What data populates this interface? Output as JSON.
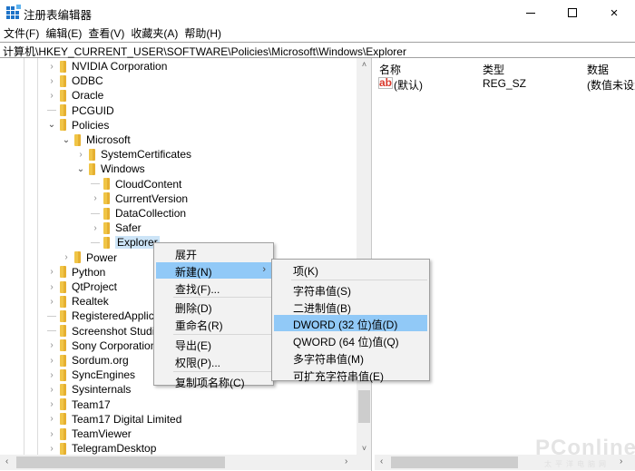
{
  "window": {
    "title": "注册表编辑器",
    "icon": "regedit-icon",
    "controls": {
      "minimize": "minimize-icon",
      "maximize": "maximize-icon",
      "close": "×"
    }
  },
  "menubar": [
    "文件(F)",
    "编辑(E)",
    "查看(V)",
    "收藏夹(A)",
    "帮助(H)"
  ],
  "address": "计算机\\HKEY_CURRENT_USER\\SOFTWARE\\Policies\\Microsoft\\Windows\\Explorer",
  "tree": [
    {
      "label": "NVIDIA Corporation",
      "level": 0,
      "state": "collapsed"
    },
    {
      "label": "ODBC",
      "level": 0,
      "state": "collapsed"
    },
    {
      "label": "Oracle",
      "level": 0,
      "state": "collapsed"
    },
    {
      "label": "PCGUID",
      "level": 0,
      "state": "leaf"
    },
    {
      "label": "Policies",
      "level": 0,
      "state": "expanded"
    },
    {
      "label": "Microsoft",
      "level": 1,
      "state": "expanded"
    },
    {
      "label": "SystemCertificates",
      "level": 2,
      "state": "collapsed"
    },
    {
      "label": "Windows",
      "level": 2,
      "state": "expanded"
    },
    {
      "label": "CloudContent",
      "level": 3,
      "state": "leaf"
    },
    {
      "label": "CurrentVersion",
      "level": 3,
      "state": "collapsed"
    },
    {
      "label": "DataCollection",
      "level": 3,
      "state": "leaf"
    },
    {
      "label": "Safer",
      "level": 3,
      "state": "collapsed"
    },
    {
      "label": "Explorer",
      "level": 3,
      "state": "leaf",
      "selected": true
    },
    {
      "label": "Power",
      "level": 1,
      "state": "collapsed"
    },
    {
      "label": "Python",
      "level": 0,
      "state": "collapsed"
    },
    {
      "label": "QtProject",
      "level": 0,
      "state": "collapsed"
    },
    {
      "label": "Realtek",
      "level": 0,
      "state": "collapsed"
    },
    {
      "label": "RegisteredApplications",
      "level": 0,
      "state": "leaf"
    },
    {
      "label": "Screenshot Studio",
      "level": 0,
      "state": "leaf"
    },
    {
      "label": "Sony Corporation",
      "level": 0,
      "state": "collapsed"
    },
    {
      "label": "Sordum.org",
      "level": 0,
      "state": "collapsed"
    },
    {
      "label": "SyncEngines",
      "level": 0,
      "state": "collapsed"
    },
    {
      "label": "Sysinternals",
      "level": 0,
      "state": "collapsed"
    },
    {
      "label": "Team17",
      "level": 0,
      "state": "collapsed"
    },
    {
      "label": "Team17 Digital Limited",
      "level": 0,
      "state": "collapsed"
    },
    {
      "label": "TeamViewer",
      "level": 0,
      "state": "collapsed"
    },
    {
      "label": "TelegramDesktop",
      "level": 0,
      "state": "collapsed"
    }
  ],
  "list": {
    "columns": [
      "名称",
      "类型",
      "数据"
    ],
    "rows": [
      {
        "icon": "ab",
        "name": "(默认)",
        "type": "REG_SZ",
        "data": "(数值未设置)"
      }
    ]
  },
  "context_menu": {
    "items": [
      {
        "label": "展开"
      },
      {
        "label": "新建(N)",
        "submenu": true,
        "highlighted": true
      },
      {
        "label": "查找(F)..."
      },
      {
        "separator": true
      },
      {
        "label": "删除(D)"
      },
      {
        "label": "重命名(R)"
      },
      {
        "separator": true
      },
      {
        "label": "导出(E)"
      },
      {
        "label": "权限(P)..."
      },
      {
        "separator": true
      },
      {
        "label": "复制项名称(C)"
      }
    ],
    "submenu_arrow": "›"
  },
  "new_submenu": {
    "items": [
      {
        "label": "项(K)"
      },
      {
        "separator": true
      },
      {
        "label": "字符串值(S)"
      },
      {
        "label": "二进制值(B)"
      },
      {
        "label": "DWORD (32 位)值(D)",
        "highlighted": true
      },
      {
        "label": "QWORD (64 位)值(Q)"
      },
      {
        "label": "多字符串值(M)"
      },
      {
        "label": "可扩充字符串值(E)"
      }
    ]
  },
  "scroll": {
    "up": "˄",
    "down": "˅",
    "left": "‹",
    "right": "›"
  },
  "watermark": {
    "text": "PConline",
    "sub": "太平洋电脑网"
  },
  "colors": {
    "highlight": "#91c9f7",
    "selection": "#cce4f7",
    "folder": "#f0c547"
  }
}
